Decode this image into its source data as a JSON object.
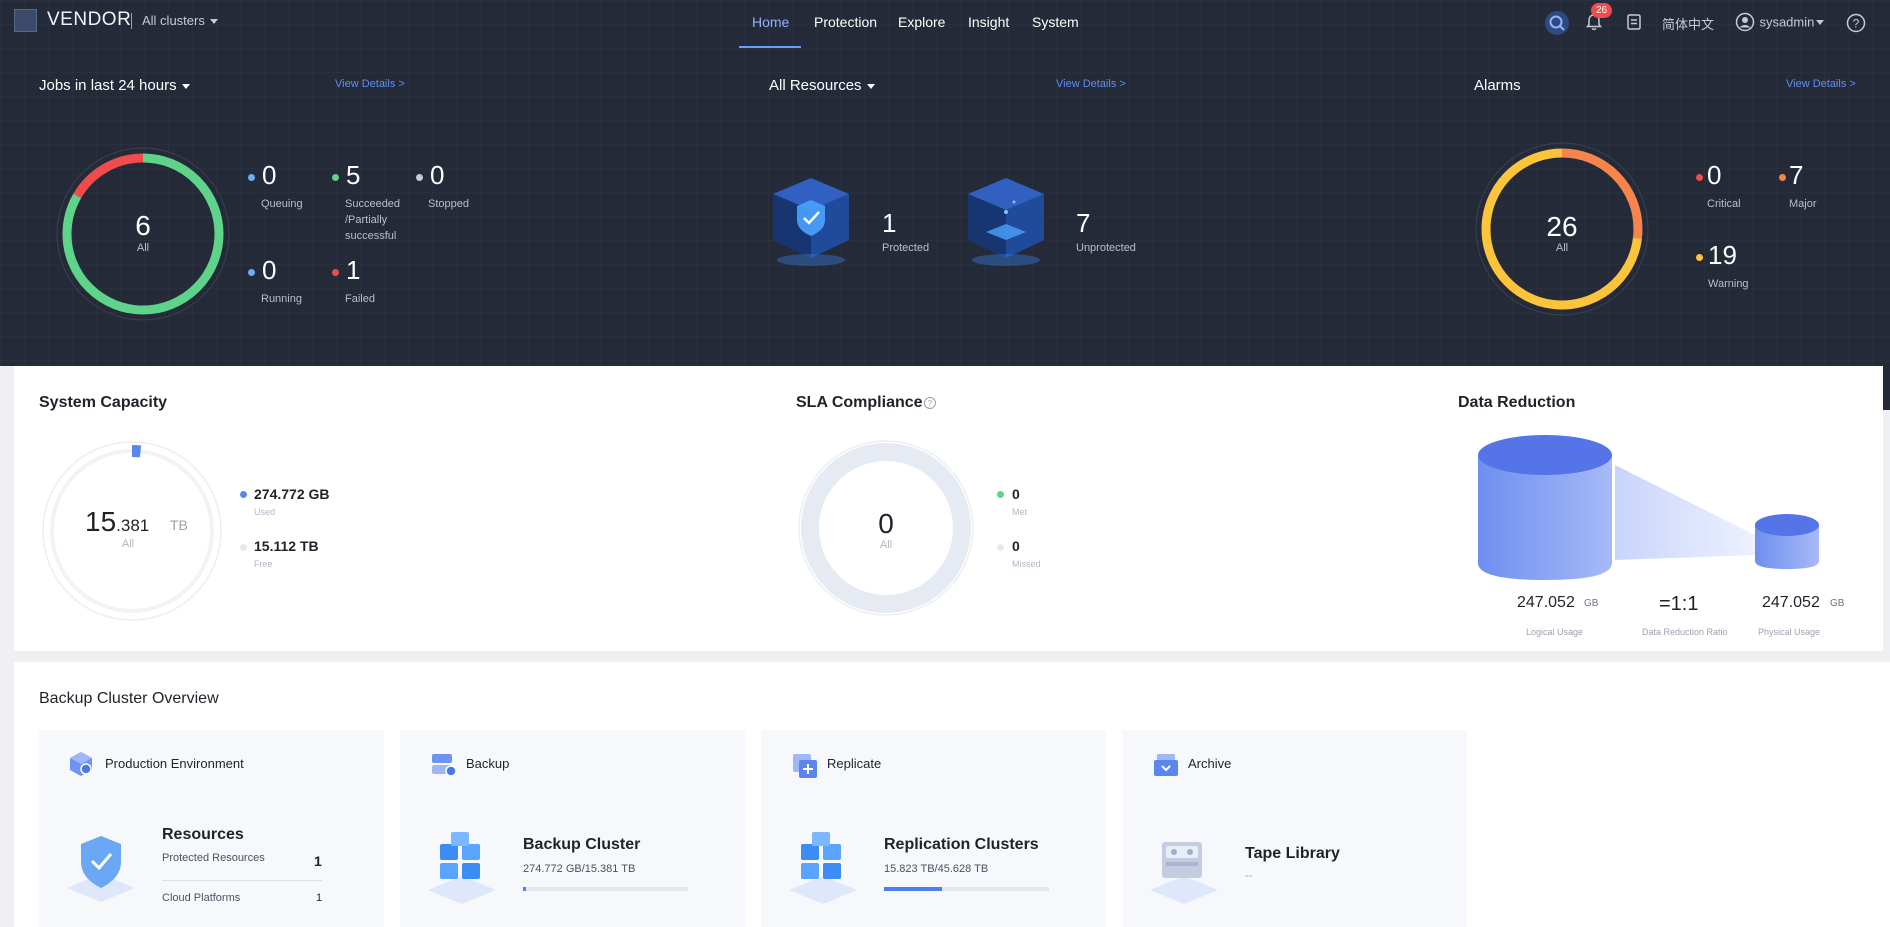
{
  "header": {
    "logo": "VENDOR",
    "cluster_selector": "All clusters",
    "nav": [
      "Home",
      "Protection",
      "Explore",
      "Insight",
      "System"
    ],
    "active_nav": "Home",
    "notifications_count": "26",
    "language": "简体中文",
    "user": "sysadmin"
  },
  "jobs": {
    "title": "Jobs in last 24 hours",
    "view_details": "View Details >",
    "total": "6",
    "total_label": "All",
    "queuing": {
      "value": "0",
      "label": "Queuing"
    },
    "succeeded": {
      "value": "5",
      "label_1": "Succeeded",
      "label_2": "/Partially",
      "label_3": "successful"
    },
    "stopped": {
      "value": "0",
      "label": "Stopped"
    },
    "running": {
      "value": "0",
      "label": "Running"
    },
    "failed": {
      "value": "1",
      "label": "Failed"
    }
  },
  "resources": {
    "title": "All Resources",
    "view_details": "View Details >",
    "protected": {
      "value": "1",
      "label": "Protected"
    },
    "unprotected": {
      "value": "7",
      "label": "Unprotected"
    }
  },
  "alarms": {
    "title": "Alarms",
    "view_details": "View Details >",
    "total": "26",
    "total_label": "All",
    "critical": {
      "value": "0",
      "label": "Critical"
    },
    "major": {
      "value": "7",
      "label": "Major"
    },
    "warning": {
      "value": "19",
      "label": "Warning"
    }
  },
  "capacity": {
    "title": "System Capacity",
    "total_int": "15",
    "total_dec": ".381",
    "total_unit": "TB",
    "total_label": "All",
    "used": {
      "value": "274.772 GB",
      "label": "Used"
    },
    "free": {
      "value": "15.112 TB",
      "label": "Free"
    },
    "used_fraction": 0.017
  },
  "sla": {
    "title": "SLA Compliance",
    "total": "0",
    "total_label": "All",
    "met": {
      "value": "0",
      "label": "Met"
    },
    "missed": {
      "value": "0",
      "label": "Missed"
    }
  },
  "reduction": {
    "title": "Data Reduction",
    "logical": {
      "value": "247.052",
      "unit": "GB",
      "label": "Logical Usage"
    },
    "ratio": {
      "value": "=1:1",
      "label": "Data Reduction Ratio"
    },
    "physical": {
      "value": "247.052",
      "unit": "GB",
      "label": "Physical Usage"
    }
  },
  "overview": {
    "title": "Backup Cluster Overview",
    "production": {
      "head": "Production Environment",
      "title": "Resources",
      "row1_label": "Protected Resources",
      "row1_value": "1",
      "row2_label": "Cloud Platforms",
      "row2_value": "1"
    },
    "backup": {
      "head": "Backup",
      "title": "Backup Cluster",
      "sub": "274.772 GB/15.381 TB",
      "fill": 0.02
    },
    "replicate": {
      "head": "Replicate",
      "title": "Replication Clusters",
      "sub": "15.823 TB/45.628 TB",
      "fill": 0.35
    },
    "archive": {
      "head": "Archive",
      "title": "Tape Library",
      "sub": "--"
    }
  },
  "colors": {
    "accent": "#6a9bff",
    "success": "#5dd48a",
    "danger": "#f04c4c",
    "major": "#f7844a",
    "warning": "#fbc43c",
    "info": "#6aaef5",
    "capacity": "#5b86ee"
  }
}
